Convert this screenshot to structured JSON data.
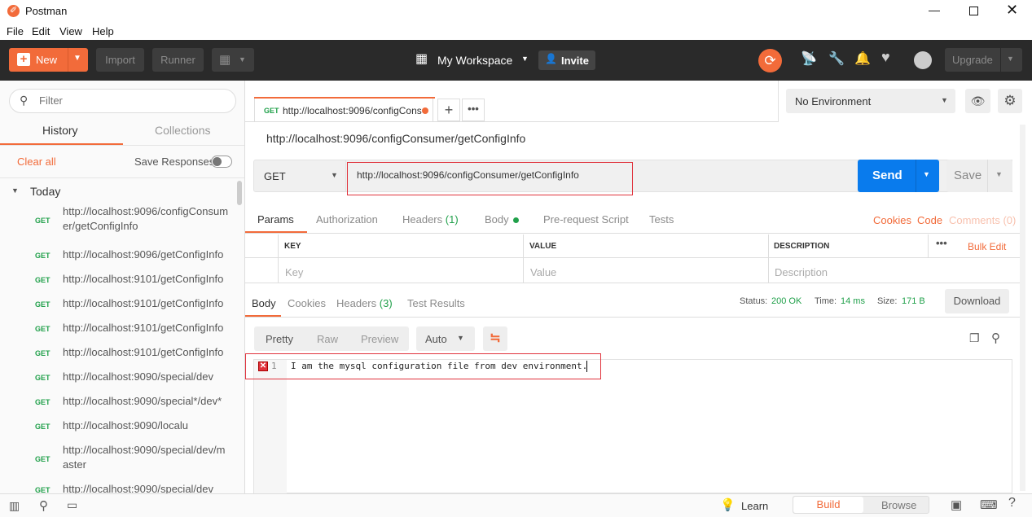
{
  "window": {
    "title": "Postman"
  },
  "menu": [
    "File",
    "Edit",
    "View",
    "Help"
  ],
  "header": {
    "new_label": "New",
    "import_label": "Import",
    "runner_label": "Runner",
    "workspace_label": "My Workspace",
    "invite_label": "Invite",
    "upgrade_label": "Upgrade"
  },
  "sidebar": {
    "filter_placeholder": "Filter",
    "tabs": {
      "history": "History",
      "collections": "Collections"
    },
    "clear_all": "Clear all",
    "save_responses": "Save Responses",
    "group": "Today",
    "items": [
      {
        "method": "GET",
        "url": "http://localhost:9096/configConsumer/getConfigInfo"
      },
      {
        "method": "GET",
        "url": "http://localhost:9096/getConfigInfo"
      },
      {
        "method": "GET",
        "url": "http://localhost:9101/getConfigInfo"
      },
      {
        "method": "GET",
        "url": "http://localhost:9101/getConfigInfo"
      },
      {
        "method": "GET",
        "url": "http://localhost:9101/getConfigInfo"
      },
      {
        "method": "GET",
        "url": "http://localhost:9101/getConfigInfo"
      },
      {
        "method": "GET",
        "url": "http://localhost:9090/special/dev"
      },
      {
        "method": "GET",
        "url": "http://localhost:9090/special*/dev*"
      },
      {
        "method": "GET",
        "url": "http://localhost:9090/localu"
      },
      {
        "method": "GET",
        "url": "http://localhost:9090/special/dev/master"
      },
      {
        "method": "GET",
        "url": "http://localhost:9090/special/dev"
      }
    ]
  },
  "request_tab": {
    "method": "GET",
    "title": "http://localhost:9096/configCons"
  },
  "environment": {
    "selected": "No Environment"
  },
  "request": {
    "name": "http://localhost:9096/configConsumer/getConfigInfo",
    "method": "GET",
    "url": "http://localhost:9096/configConsumer/getConfigInfo",
    "send_label": "Send",
    "save_label": "Save"
  },
  "request_tabs": {
    "params": "Params",
    "authorization": "Authorization",
    "headers": "Headers",
    "headers_count": "(1)",
    "body": "Body",
    "prerequest": "Pre-request Script",
    "tests": "Tests",
    "cookies": "Cookies",
    "code": "Code",
    "comments": "Comments (0)"
  },
  "params_table": {
    "headers": {
      "key": "KEY",
      "value": "VALUE",
      "description": "DESCRIPTION"
    },
    "bulk_edit": "Bulk Edit",
    "placeholders": {
      "key": "Key",
      "value": "Value",
      "description": "Description"
    }
  },
  "response": {
    "tabs": {
      "body": "Body",
      "cookies": "Cookies",
      "headers": "Headers",
      "headers_count": "(3)",
      "test_results": "Test Results"
    },
    "status_label": "Status:",
    "status_value": "200 OK",
    "time_label": "Time:",
    "time_value": "14 ms",
    "size_label": "Size:",
    "size_value": "171 B",
    "download_label": "Download",
    "view_modes": {
      "pretty": "Pretty",
      "raw": "Raw",
      "preview": "Preview"
    },
    "format": "Auto",
    "line_number": "1",
    "body_text": "I am the mysql configuration file from dev environment."
  },
  "footer": {
    "learn": "Learn",
    "build": "Build",
    "browse": "Browse"
  },
  "colors": {
    "accent": "#f26b3a",
    "send": "#097bed",
    "get": "#20a04a",
    "status": "#20a04a",
    "highlight_box": "#e0323c"
  }
}
